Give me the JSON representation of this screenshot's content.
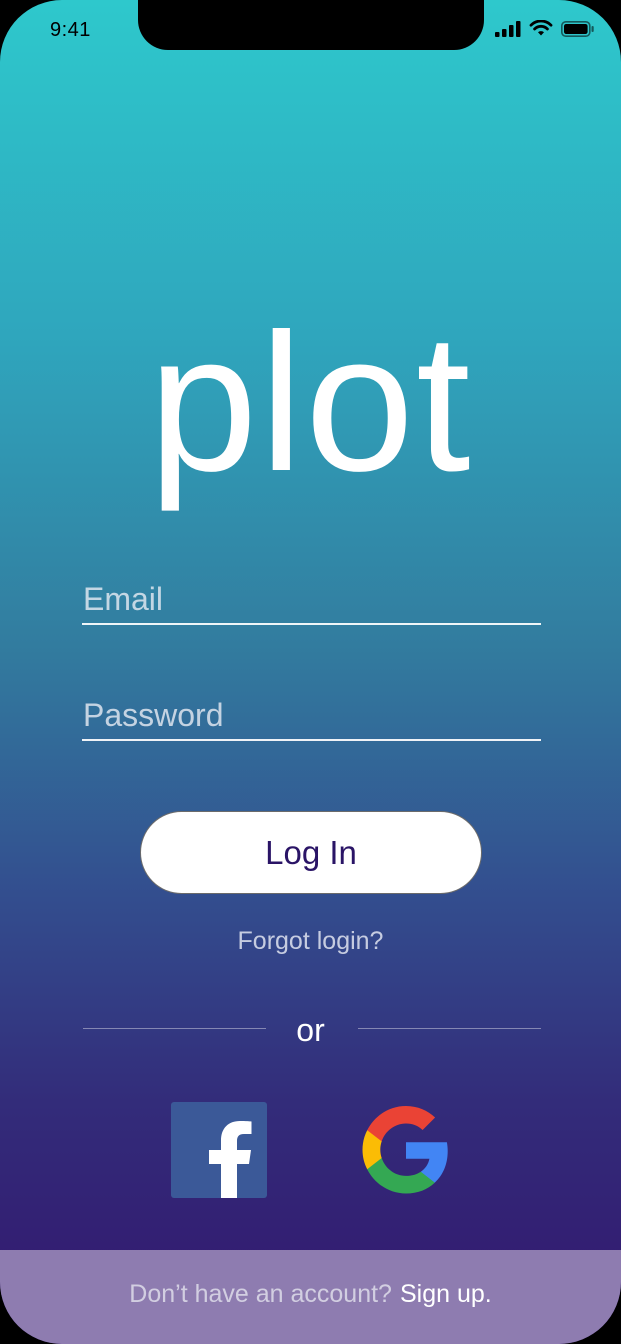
{
  "status_bar": {
    "time": "9:41"
  },
  "app": {
    "logo_text": "plot"
  },
  "form": {
    "email_placeholder": "Email",
    "email_value": "",
    "password_placeholder": "Password",
    "password_value": "",
    "login_label": "Log In",
    "forgot_label": "Forgot login?"
  },
  "divider": {
    "label": "or"
  },
  "social": [
    {
      "icon": "facebook-icon",
      "color": "#3b5998"
    },
    {
      "icon": "google-icon",
      "colors": [
        "#ea4335",
        "#fbbc05",
        "#34a853",
        "#4285f4"
      ]
    }
  ],
  "footer": {
    "prompt": "Don’t have an account?",
    "link": "Sign up."
  },
  "colors": {
    "gradient_top": "#2ec8cc",
    "gradient_bottom": "#33166e",
    "button_text": "#2a1466",
    "footer_bg": "#8e7cb0"
  }
}
